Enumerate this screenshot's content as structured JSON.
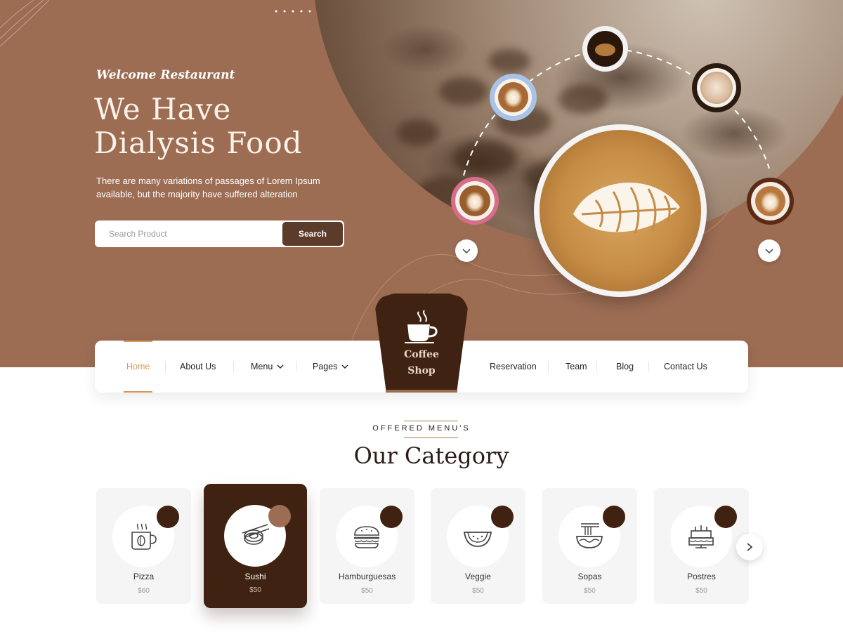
{
  "hero": {
    "welcome": "Welcome Restaurant",
    "title": "We Have Dialysis Food",
    "subtitle": "There are many variations of passages of Lorem Ipsum available, but the majority have suffered alteration",
    "search": {
      "placeholder": "Search Product",
      "button_label": "Search"
    }
  },
  "nav": {
    "items": [
      {
        "label": "Home",
        "active": true
      },
      {
        "label": "About Us"
      },
      {
        "label": "Menu",
        "dropdown": true
      },
      {
        "label": "Pages",
        "dropdown": true
      },
      {
        "label": "Reservation"
      },
      {
        "label": "Team"
      },
      {
        "label": "Blog"
      },
      {
        "label": "Contact Us"
      }
    ]
  },
  "logo": {
    "line1": "Coffee",
    "line2": "Shop"
  },
  "section": {
    "kicker": "OFFERED MENU'S",
    "title": "Our Category"
  },
  "categories": [
    {
      "name": "Pizza",
      "price": "$60",
      "icon": "coffee-mug-icon"
    },
    {
      "name": "Sushi",
      "price": "$50",
      "icon": "sushi-icon",
      "active": true
    },
    {
      "name": "Hamburguesas",
      "price": "$50",
      "icon": "burger-icon"
    },
    {
      "name": "Veggie",
      "price": "$50",
      "icon": "watermelon-icon"
    },
    {
      "name": "Sopas",
      "price": "$50",
      "icon": "noodle-bowl-icon"
    },
    {
      "name": "Postres",
      "price": "$50",
      "icon": "cake-icon"
    }
  ],
  "colors": {
    "hero_brown": "#9c6c53",
    "dark_brown": "#3f2212",
    "accent": "#d59a55",
    "button_brown": "#5b3b2a"
  }
}
